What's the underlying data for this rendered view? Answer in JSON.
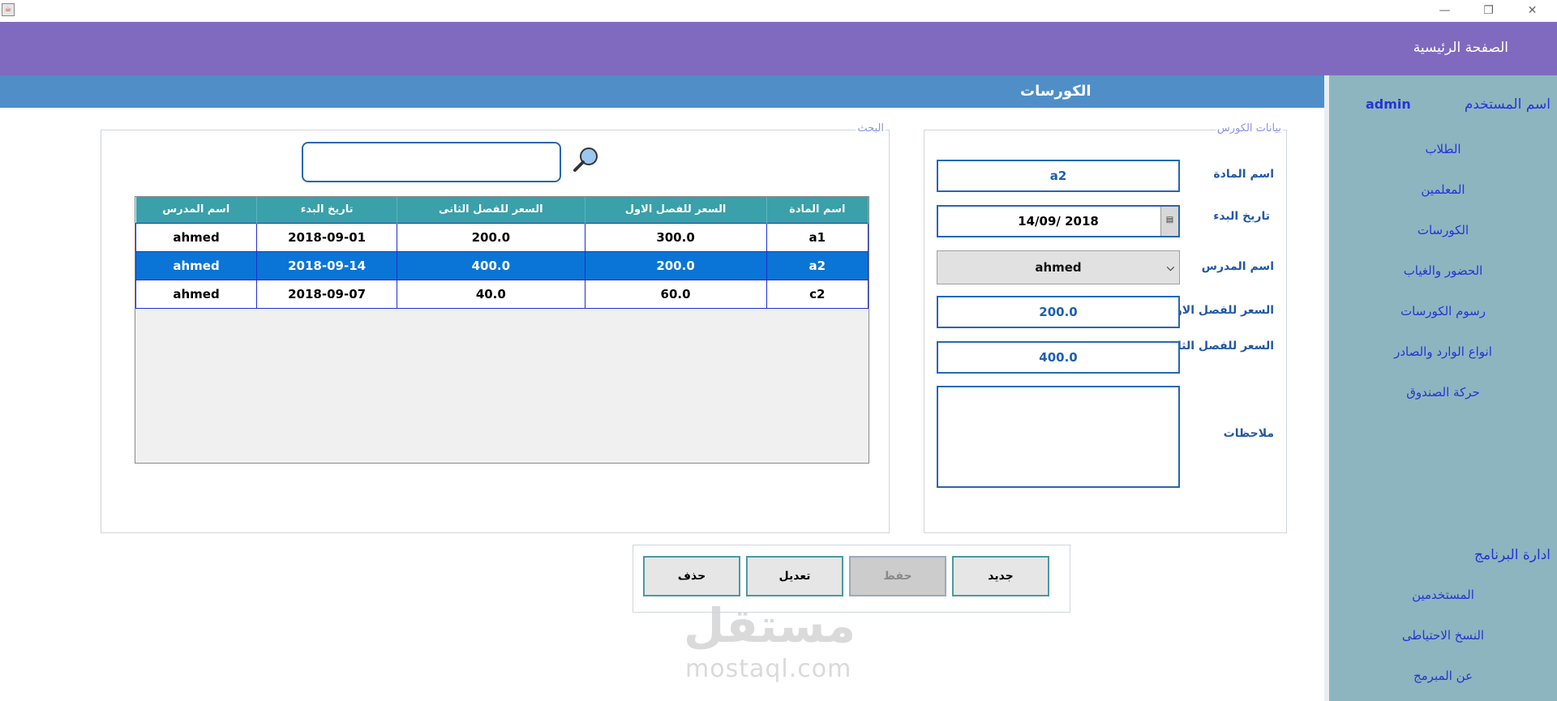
{
  "window": {
    "minimize": "—",
    "restore": "❐",
    "close": "✕"
  },
  "header": {
    "home": "الصفحة الرئيسية"
  },
  "banner": {
    "title": "الكورسات"
  },
  "sidebar": {
    "user_label": "اسم المستخدم",
    "user_value": "admin",
    "items": [
      "الطلاب",
      "المعلمين",
      "الكورسات",
      "الحضور والغياب",
      "رسوم الكورسات",
      "انواع الوارد والصادر",
      "حركة الصندوق"
    ],
    "admin_title": "ادارة البرنامج",
    "admin_items": [
      "المستخدمين",
      "النسخ الاحتياطى",
      "عن المبرمج"
    ]
  },
  "form": {
    "legend": "بيانات الكورس",
    "subject_label": "اسم المادة",
    "subject_value": "a2",
    "start_label": "تاريخ البدء",
    "start_value": "14/09/ 2018",
    "teacher_label": "اسم المدرس",
    "teacher_value": "ahmed",
    "price1_label": "السعر للفصل الاول",
    "price1_value": "200.0",
    "price2_label": "السعر للفصل الثانى",
    "price2_value": "400.0",
    "notes_label": "ملاحظات",
    "notes_value": ""
  },
  "search": {
    "legend": "البحث",
    "value": ""
  },
  "table": {
    "headers": [
      "اسم المادة",
      "السعر للفصل الاول",
      "السعر للفصل الثانى",
      "تاريخ البدء",
      "اسم المدرس"
    ],
    "rows": [
      [
        "a1",
        "300.0",
        "200.0",
        "2018-09-01",
        "ahmed"
      ],
      [
        "a2",
        "200.0",
        "400.0",
        "2018-09-14",
        "ahmed"
      ],
      [
        "c2",
        "60.0",
        "40.0",
        "2018-09-07",
        "ahmed"
      ]
    ],
    "selected_row": 1
  },
  "buttons": {
    "new": "جديد",
    "save": "حفظ",
    "edit": "تعديل",
    "delete": "حذف"
  },
  "watermark": {
    "arabic": "مستقل",
    "english": "mostaql.com"
  },
  "colors": {
    "header": "#7f6abf",
    "banner": "#4f8ec7",
    "sidebar": "#8db5bf",
    "table_header": "#3aa0aa",
    "selection": "#0a75d6",
    "link": "#2633d9"
  }
}
